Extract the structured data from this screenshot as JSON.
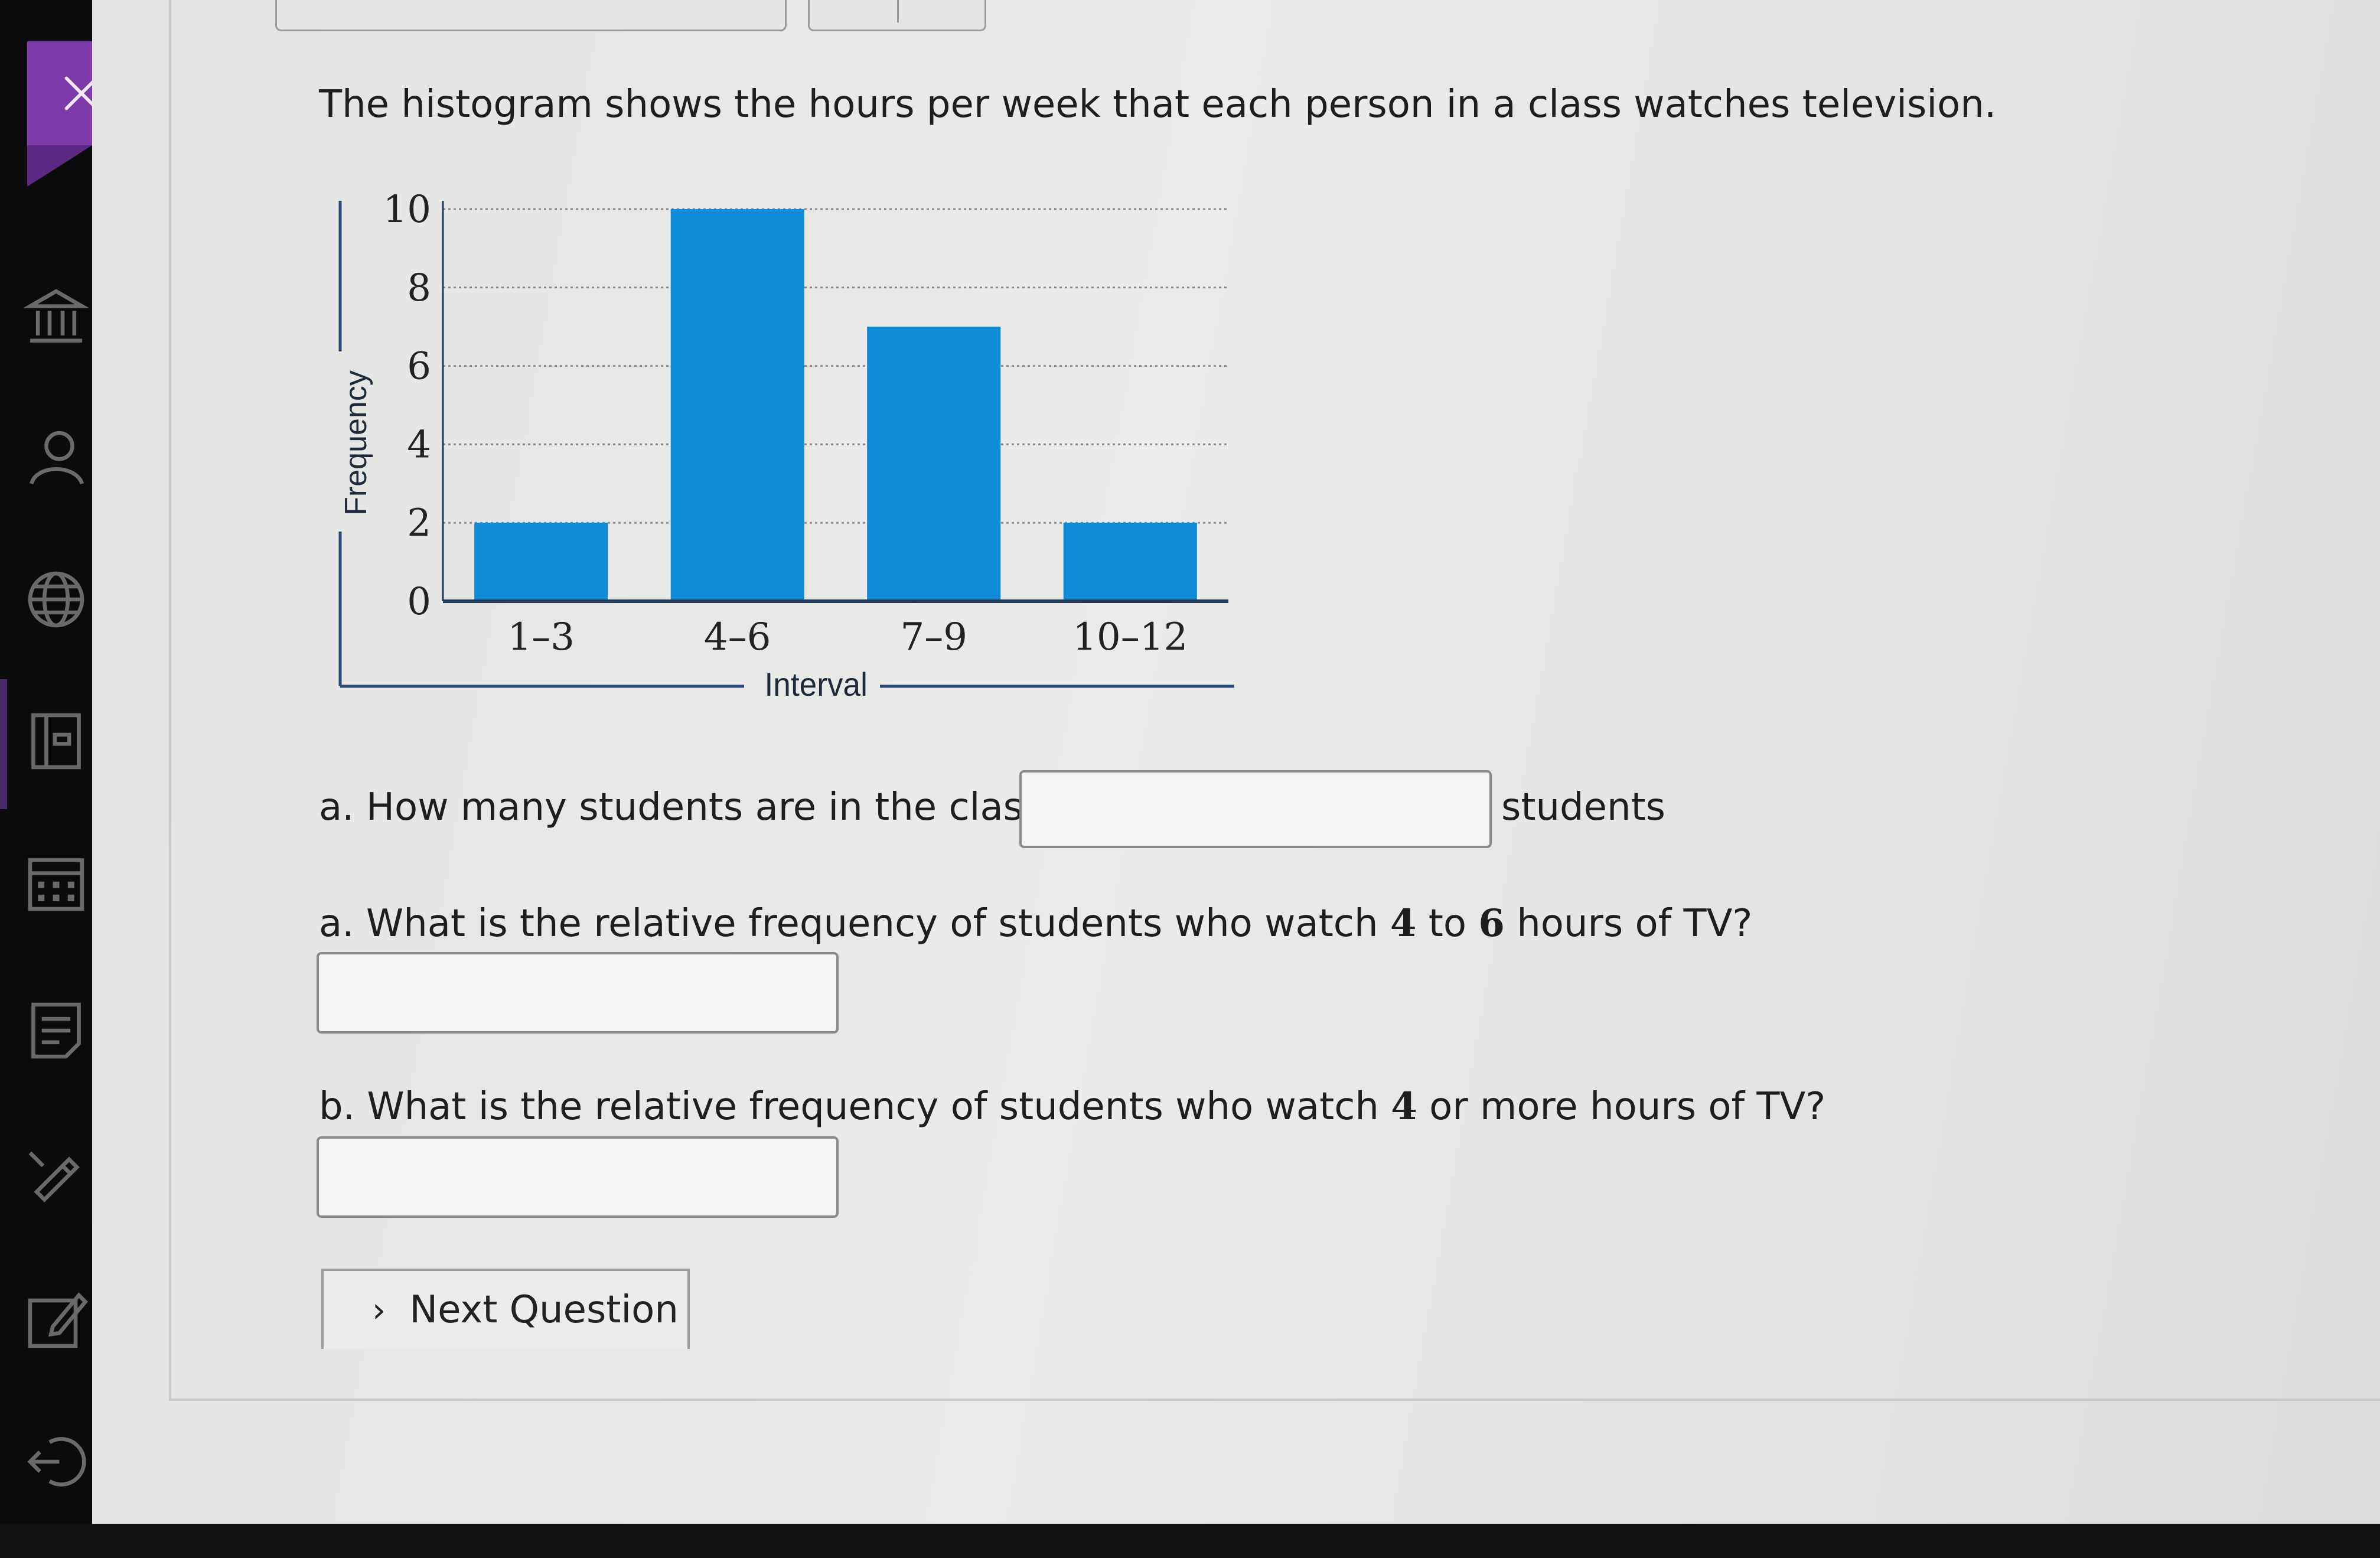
{
  "close_tab": {
    "icon": "close-icon"
  },
  "sidebar": {
    "items": [
      {
        "icon": "bank-icon"
      },
      {
        "icon": "person-icon"
      },
      {
        "icon": "globe-icon"
      },
      {
        "icon": "book-icon"
      },
      {
        "icon": "calendar-icon"
      },
      {
        "icon": "notes-icon"
      },
      {
        "icon": "pencil-icon"
      },
      {
        "icon": "edit-icon"
      },
      {
        "icon": "logout-icon"
      }
    ]
  },
  "question": {
    "intro": "The histogram shows the hours per week that each person in a class watches television.",
    "part_a1": {
      "prefix": "a. How many students are in the class?",
      "suffix": "students",
      "value": ""
    },
    "part_a2": {
      "pre": "a. What is the relative frequency of students who watch ",
      "n1": "4",
      "mid": " to ",
      "n2": "6",
      "post": " hours of TV?",
      "value": ""
    },
    "part_b": {
      "pre": "b. What is the relative frequency of students who watch ",
      "n1": "4",
      "post": " or more hours of TV?",
      "value": ""
    }
  },
  "next_button": {
    "label": "Next Question",
    "icon": "chevron-right-icon"
  },
  "chart_data": {
    "type": "bar",
    "categories": [
      "1–3",
      "4–6",
      "7–9",
      "10–12"
    ],
    "values": [
      2,
      10,
      7,
      2
    ],
    "xlabel": "Interval",
    "ylabel": "Frequency",
    "ylim": [
      0,
      10
    ],
    "yticks": [
      0,
      2,
      4,
      6,
      8,
      10
    ],
    "grid": true,
    "bar_color": "#0e8ad6"
  }
}
